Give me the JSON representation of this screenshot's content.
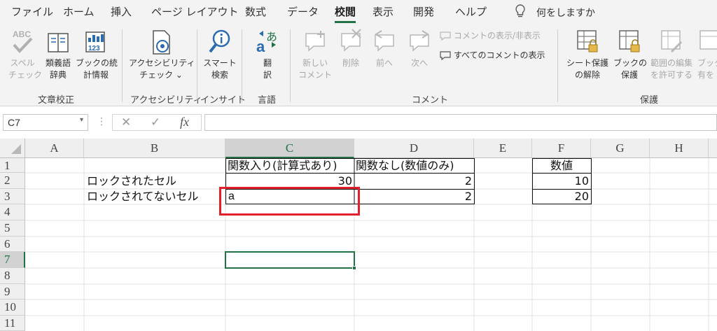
{
  "tabs": [
    "ファイル",
    "ホーム",
    "挿入",
    "ページ レイアウト",
    "数式",
    "データ",
    "校閲",
    "表示",
    "開発",
    "ヘルプ"
  ],
  "active_tab": "校閲",
  "tell_me": "何をしますか",
  "ribbon": {
    "proofing": {
      "spell_1": "スペル",
      "spell_2": "チェック",
      "thesaurus_1": "類義語",
      "thesaurus_2": "辞典",
      "stats_1": "ブックの統",
      "stats_2": "計情報",
      "group": "文章校正"
    },
    "accessibility": {
      "check_1": "アクセシビリティ",
      "check_2": "チェック ⌄",
      "group": "アクセシビリティ"
    },
    "insights": {
      "smart_1": "スマート",
      "smart_2": "検索",
      "group": "インサイト"
    },
    "language": {
      "translate_1": "翻",
      "translate_2": "訳",
      "group": "言語"
    },
    "comments": {
      "new_1": "新しい",
      "new_2": "コメント",
      "delete": "削除",
      "prev": "前へ",
      "next": "次へ",
      "show_hide": "コメントの表示/非表示",
      "show_all": "すべてのコメントの表示",
      "group": "コメント"
    },
    "protect": {
      "unprotect_1": "シート保護",
      "unprotect_2": "の解除",
      "protect_book_1": "ブックの",
      "protect_book_2": "保護",
      "allow_1": "範囲の編集",
      "allow_2": "を許可する",
      "share_1": "ブック",
      "share_2": "有を",
      "group": "保護"
    }
  },
  "formula_bar": {
    "name_box": "C7",
    "fx": "fx",
    "formula": ""
  },
  "selected_cell": "C7",
  "columns": [
    "A",
    "B",
    "C",
    "D",
    "E",
    "F",
    "G",
    "H"
  ],
  "rows": [
    "1",
    "2",
    "3",
    "4",
    "5",
    "6",
    "7",
    "8",
    "9",
    "10",
    "11"
  ],
  "cells": {
    "C1": "関数入り(計算式あり)",
    "D1": "関数なし(数値のみ)",
    "F1": "数値",
    "B2": "ロックされたセル",
    "C2": "30",
    "D2": "2",
    "F2": "10",
    "B3": "ロックされてないセル",
    "C3": "a",
    "D3": "2",
    "F3": "20"
  },
  "colors": {
    "accent": "#217346",
    "highlight": "#e0202a"
  }
}
